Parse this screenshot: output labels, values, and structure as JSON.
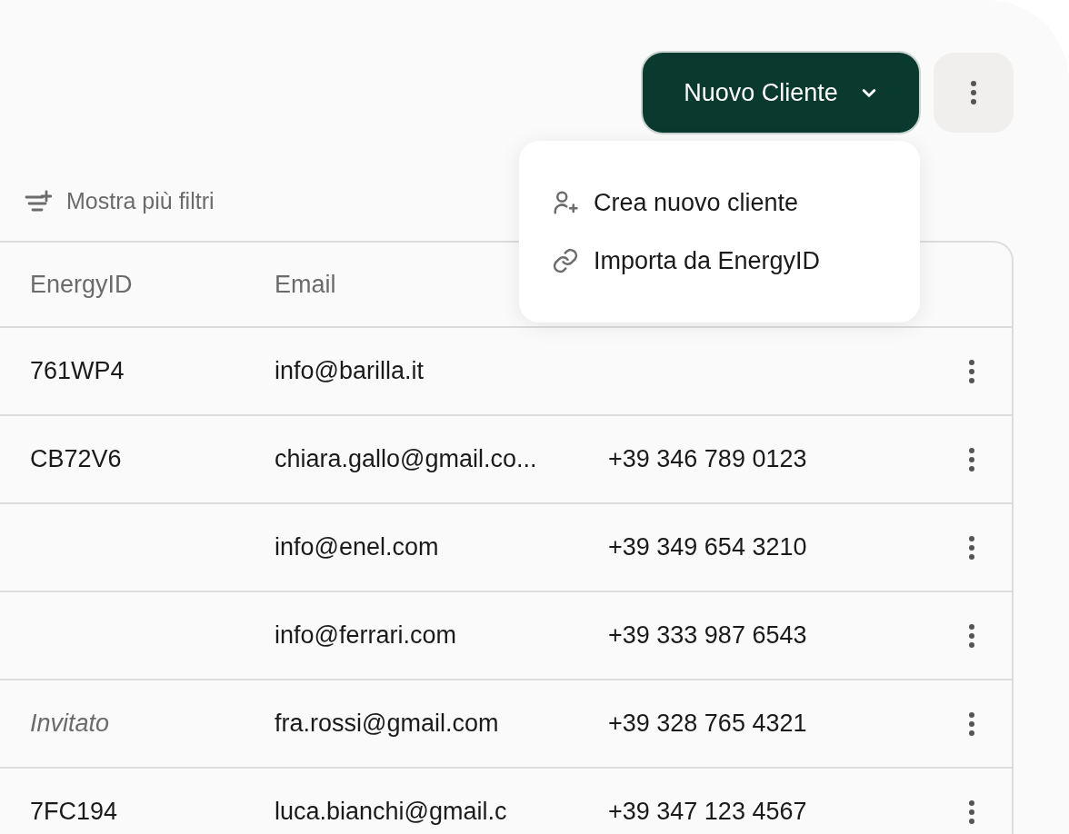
{
  "toolbar": {
    "primary_button": {
      "label": "Nuovo Cliente",
      "expanded": true
    }
  },
  "menu": {
    "items": [
      {
        "kind": "create",
        "label": "Crea nuovo cliente"
      },
      {
        "kind": "import",
        "label": "Importa da EnergyID"
      }
    ]
  },
  "filters": {
    "label": "Mostra più filtri"
  },
  "table": {
    "columns": [
      "EnergyID",
      "Email"
    ],
    "rows": [
      {
        "energy_id": "761WP4",
        "email": "info@barilla.it"
      },
      {
        "energy_id": "CB72V6",
        "email": "chiara.gallo@gmail.co...",
        "phone": "+39 346 789 0123"
      },
      {
        "email": "info@enel.com",
        "phone": "+39 349 654 3210"
      },
      {
        "email": "info@ferrari.com",
        "phone": "+39 333 987 6543"
      },
      {
        "energy_id": "Invitato",
        "invited": true,
        "email": "fra.rossi@gmail.com",
        "phone": "+39 328 765 4321"
      },
      {
        "energy_id": "7FC194",
        "email": "luca.bianchi@gmail.c",
        "phone": "+39 347 123 4567"
      }
    ]
  }
}
